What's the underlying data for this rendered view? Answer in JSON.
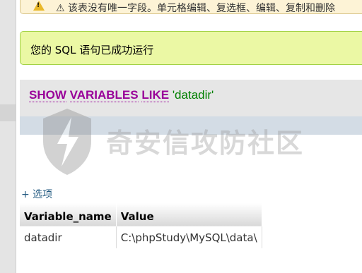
{
  "warning": {
    "text": "⚠ 该表没有唯一字段。单元格编辑、复选框、编辑、复制和删除"
  },
  "success": {
    "message": "您的 SQL 语句已成功运行"
  },
  "query": {
    "kw_show": "SHOW",
    "kw_variables": "VARIABLES",
    "kw_like": "LIKE",
    "string": "'datadir'"
  },
  "watermark": {
    "text": "奇安信攻防社区"
  },
  "options": {
    "label": "+ 选项"
  },
  "results": {
    "headers": [
      "Variable_name",
      "Value"
    ],
    "rows": [
      [
        "datadir",
        "C:\\phpStudy\\MySQL\\data\\"
      ]
    ]
  },
  "colors": {
    "success_bg": "#ebf8a4",
    "keyword": "#990099",
    "string": "#008000",
    "link": "#235a81"
  }
}
